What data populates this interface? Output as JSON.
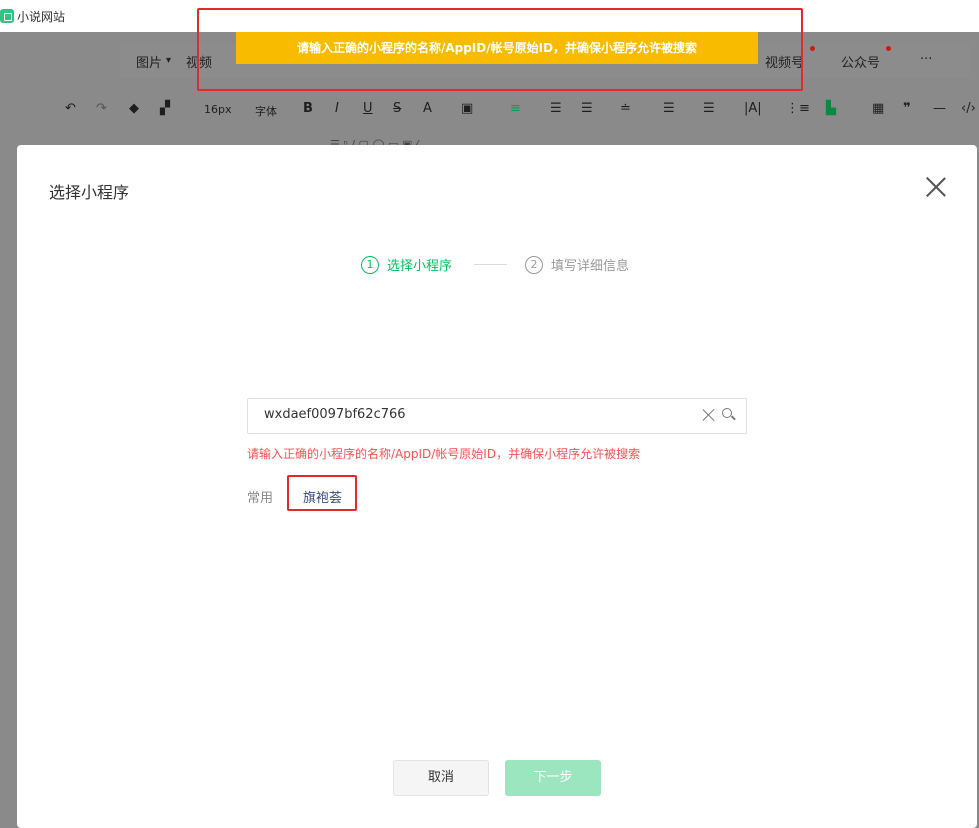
{
  "app": {
    "title": "小说网站"
  },
  "toast": {
    "message": "请输入正确的小程序的名称/AppID/帐号原始ID，并确保小程序允许被搜索"
  },
  "insert_toolbar": {
    "items": [
      "图片",
      "视频",
      "视频号",
      "公众号",
      "···"
    ]
  },
  "format_toolbar": {
    "font_size": "16px",
    "font_family": "字体"
  },
  "dialog": {
    "title": "选择小程序",
    "steps": [
      {
        "num": "1",
        "label": "选择小程序"
      },
      {
        "num": "2",
        "label": "填写详细信息"
      }
    ],
    "search": {
      "value": "wxdaef0097bf62c766"
    },
    "error": "请输入正确的小程序的名称/AppID/帐号原始ID，并确保小程序允许被搜索",
    "recent": {
      "label": "常用",
      "items": [
        "旗袍荟"
      ]
    },
    "buttons": {
      "cancel": "取消",
      "next": "下一步"
    }
  },
  "colors": {
    "accent": "#07c160",
    "toast_bg": "#f8bb00",
    "error": "#fa5151",
    "highlight_box": "#e32929"
  }
}
